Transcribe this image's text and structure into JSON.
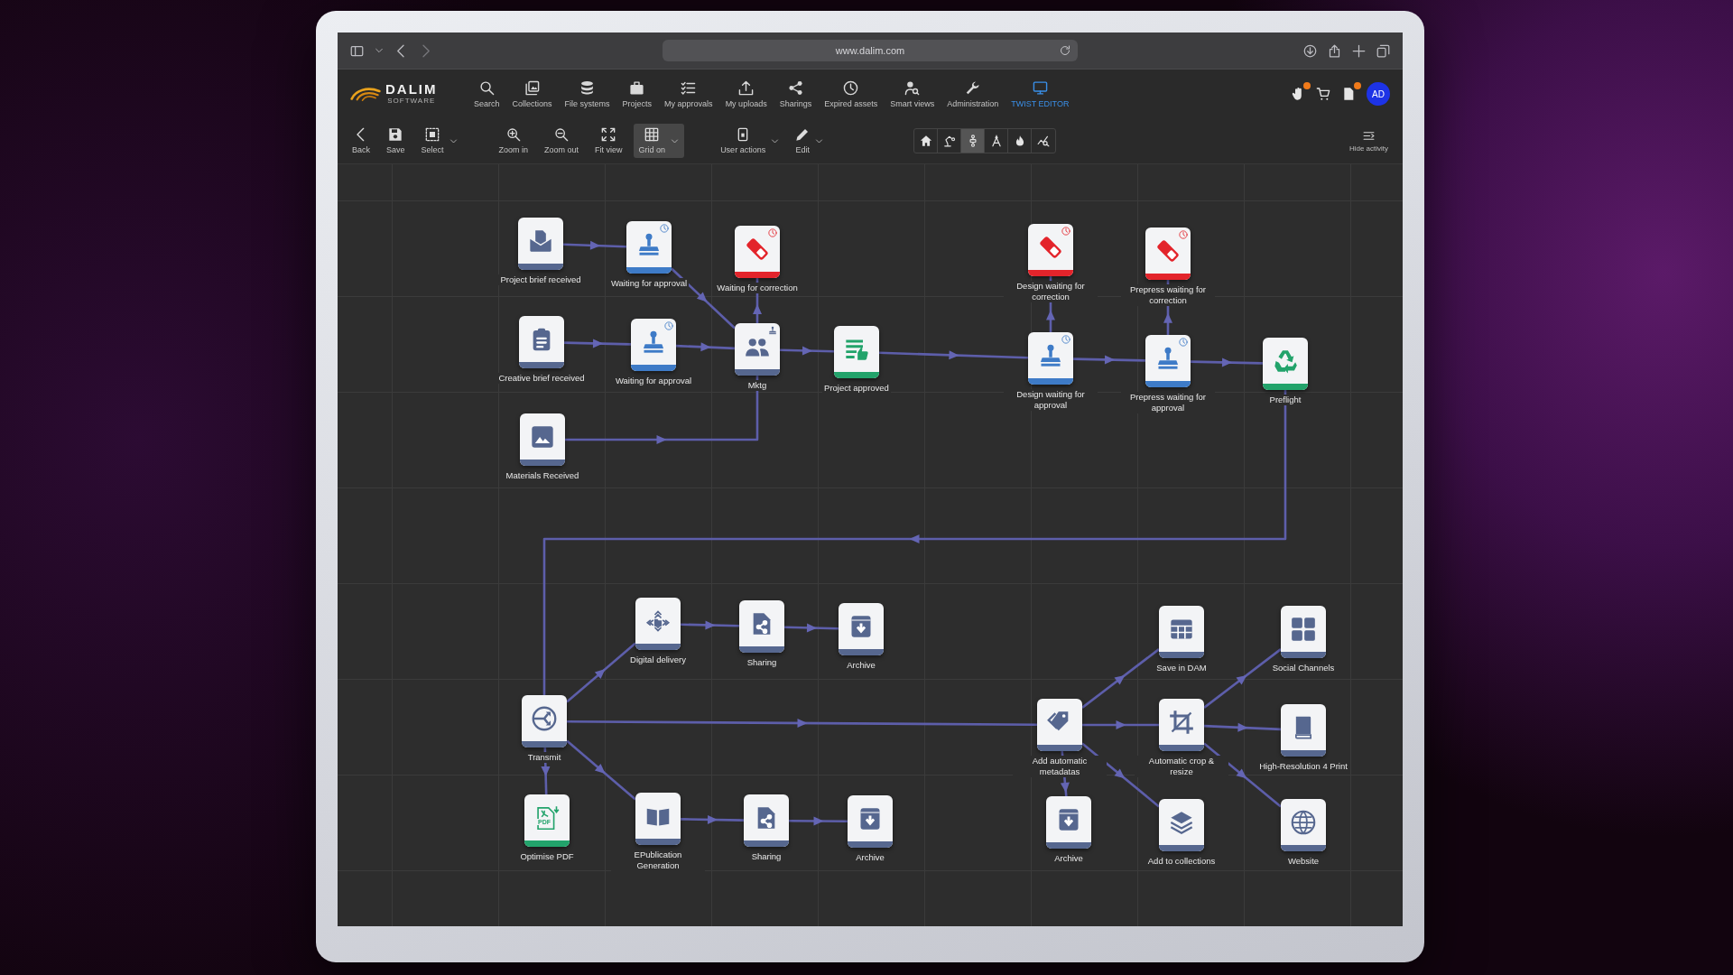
{
  "browser": {
    "url": "www.dalim.com"
  },
  "header": {
    "logo": {
      "name": "DALIM",
      "tagline": "SOFTWARE"
    },
    "nav": [
      {
        "label": "Search",
        "selected": false
      },
      {
        "label": "Collections",
        "selected": false
      },
      {
        "label": "File systems",
        "selected": false
      },
      {
        "label": "Projects",
        "selected": false
      },
      {
        "label": "My approvals",
        "selected": false
      },
      {
        "label": "My uploads",
        "selected": false
      },
      {
        "label": "Sharings",
        "selected": false
      },
      {
        "label": "Expired assets",
        "selected": false
      },
      {
        "label": "Smart views",
        "selected": false
      },
      {
        "label": "Administration",
        "selected": false
      },
      {
        "label": "TWIST EDITOR",
        "selected": true
      }
    ],
    "notifications": [
      {
        "badge": true
      },
      {
        "badge": false
      },
      {
        "badge": true
      }
    ],
    "user": {
      "initials": "AD"
    }
  },
  "toolbar": {
    "groups": [
      {
        "tools": [
          {
            "label": "Back",
            "dropdown": false,
            "on": false
          },
          {
            "label": "Save",
            "dropdown": false,
            "on": false
          },
          {
            "label": "Select",
            "dropdown": true,
            "on": false
          }
        ]
      },
      {
        "tools": [
          {
            "label": "Zoom in",
            "dropdown": false,
            "on": false
          },
          {
            "label": "Zoom out",
            "dropdown": false,
            "on": false
          },
          {
            "label": "Fit view",
            "dropdown": false,
            "on": false
          },
          {
            "label": "Grid on",
            "dropdown": true,
            "on": true
          }
        ]
      },
      {
        "tools": [
          {
            "label": "User actions",
            "dropdown": true,
            "on": false
          },
          {
            "label": "Edit",
            "dropdown": true,
            "on": false
          }
        ]
      }
    ],
    "view_modes": [
      {
        "selected": false
      },
      {
        "selected": false
      },
      {
        "selected": true
      },
      {
        "selected": false
      },
      {
        "selected": false
      },
      {
        "selected": false
      }
    ],
    "activity": {
      "label": "Hide activity"
    }
  },
  "workflow": {
    "nodes": [
      {
        "label": "Project brief received",
        "kind": "intake",
        "color": "#56678f"
      },
      {
        "label": "Waiting for approval",
        "kind": "approval",
        "color": "#3e7bc7"
      },
      {
        "label": "Waiting for correction",
        "kind": "correction",
        "color": "#e3242b"
      },
      {
        "label": "Creative brief received",
        "kind": "brief",
        "color": "#56678f"
      },
      {
        "label": "Waiting for approval",
        "kind": "approval",
        "color": "#3e7bc7"
      },
      {
        "label": "Mktg",
        "kind": "review",
        "color": "#56678f"
      },
      {
        "label": "Project approved",
        "kind": "approved",
        "color": "#22a36b"
      },
      {
        "label": "Materials Received",
        "kind": "materials",
        "color": "#56678f"
      },
      {
        "label": "Design waiting for correction",
        "kind": "correction",
        "color": "#e3242b"
      },
      {
        "label": "Prepress waiting for correction",
        "kind": "correction",
        "color": "#e3242b"
      },
      {
        "label": "Design waiting for approval",
        "kind": "approval",
        "color": "#3e7bc7"
      },
      {
        "label": "Prepress waiting for approval",
        "kind": "approval",
        "color": "#3e7bc7"
      },
      {
        "label": "Preflight",
        "kind": "preflight",
        "color": "#22a36b"
      },
      {
        "label": "Digital delivery",
        "kind": "delivery",
        "color": "#56678f"
      },
      {
        "label": "Sharing",
        "kind": "sharing",
        "color": "#56678f"
      },
      {
        "label": "Archive",
        "kind": "archive",
        "color": "#56678f"
      },
      {
        "label": "Transmit",
        "kind": "transmit",
        "color": "#56678f"
      },
      {
        "label": "Optimise PDF",
        "kind": "pdf",
        "color": "#22a36b",
        "icon_text": "PDF"
      },
      {
        "label": "EPublication Generation",
        "kind": "epub",
        "color": "#56678f"
      },
      {
        "label": "Sharing",
        "kind": "sharing",
        "color": "#56678f"
      },
      {
        "label": "Archive",
        "kind": "archive",
        "color": "#56678f"
      },
      {
        "label": "Add automatic metadatas",
        "kind": "metadata",
        "color": "#56678f"
      },
      {
        "label": "Save in DAM",
        "kind": "dam",
        "color": "#56678f"
      },
      {
        "label": "Social Channels",
        "kind": "social",
        "color": "#56678f"
      },
      {
        "label": "Automatic crop & resize",
        "kind": "crop",
        "color": "#56678f"
      },
      {
        "label": "High-Resolution 4 Print",
        "kind": "print",
        "color": "#56678f"
      },
      {
        "label": "Archive",
        "kind": "archive",
        "color": "#56678f"
      },
      {
        "label": "Add to collections",
        "kind": "collection",
        "color": "#56678f"
      },
      {
        "label": "Website",
        "kind": "website",
        "color": "#56678f"
      }
    ]
  }
}
